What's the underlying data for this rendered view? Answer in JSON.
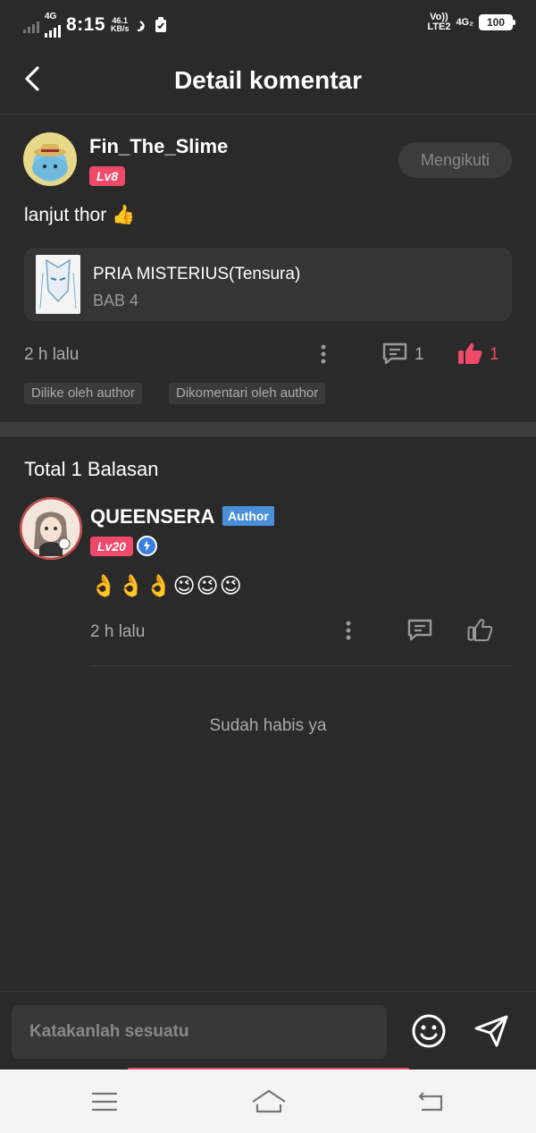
{
  "status_bar": {
    "network_left": "4G",
    "time": "8:15",
    "speed_value": "46.1",
    "speed_unit": "KB/s",
    "volte": "Vo))",
    "lte": "LTE2",
    "network_right": "4G₂",
    "battery": "100"
  },
  "header": {
    "title": "Detail komentar"
  },
  "comment": {
    "username": "Fin_The_Slime",
    "level": "Lv8",
    "follow_label": "Mengikuti",
    "text": "lanjut thor 👍",
    "book_title": "PRIA MISTERIUS(Tensura)",
    "book_chapter": "BAB 4",
    "time": "2 h lalu",
    "reply_count": "1",
    "like_count": "1",
    "tags": [
      "Dilike oleh author",
      "Dikomentari oleh author"
    ]
  },
  "replies": {
    "total_label": "Total 1 Balasan",
    "items": [
      {
        "username": "QUEENSERA",
        "badge": "Author",
        "level": "Lv20",
        "text": "👌👌👌😉😉😉",
        "time": "2 h lalu"
      }
    ],
    "end_label": "Sudah habis ya"
  },
  "input": {
    "placeholder": "Katakanlah sesuatu"
  },
  "colors": {
    "background": "#2a2a2a",
    "accent": "#f04a6a",
    "author_badge": "#4a90d9"
  }
}
